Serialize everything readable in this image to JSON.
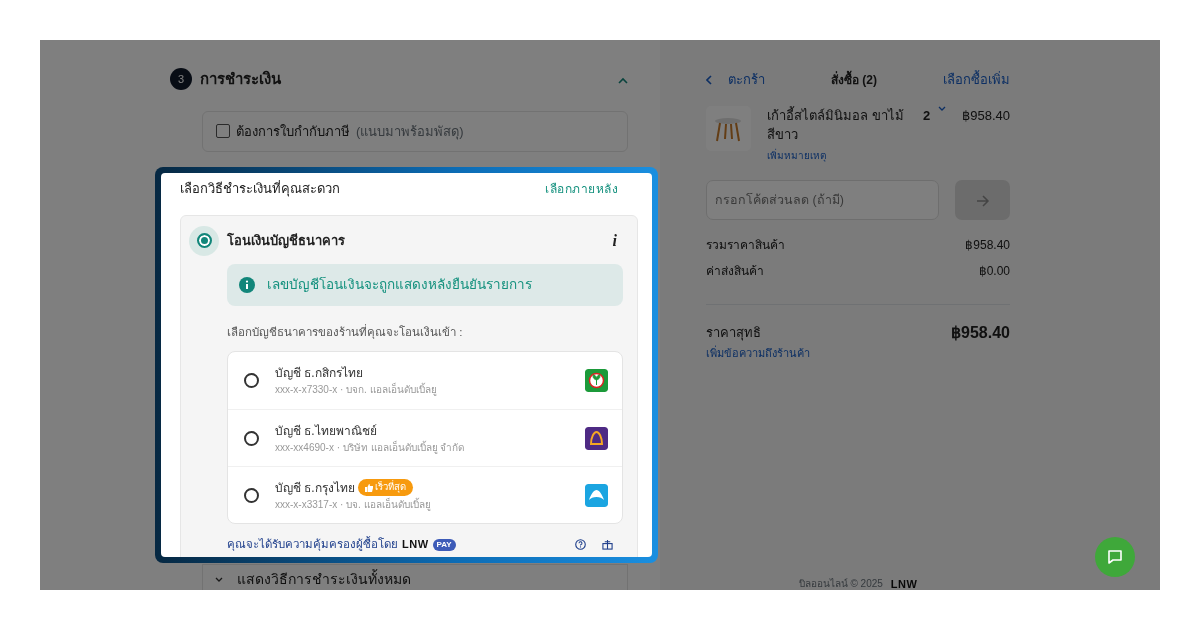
{
  "checkout": {
    "step_number": "3",
    "title": "การชำระเงิน",
    "expanded": true,
    "tax_invoice": {
      "label": "ต้องการใบกำกับภาษี",
      "note": "(แนบมาพร้อมพัสดุ)",
      "checked": false
    },
    "show_all": "แสดงวิธีการชำระเงินทั้งหมด"
  },
  "modal": {
    "title": "เลือกวิธีชำระเงินที่คุณสะดวก",
    "later_link": "เลือกภายหลัง",
    "method": {
      "label": "โอนเงินบัญชีธนาคาร",
      "selected": true,
      "info_glyph": "i",
      "notice": "เลขบัญชีโอนเงินจะถูกแสดงหลังยืนยันรายการ",
      "prompt": "เลือกบัญชีธนาคารของร้านที่คุณจะโอนเงินเข้า :",
      "banks": [
        {
          "name": "บัญชี ธ.กสิกรไทย",
          "detail": "xxx-x-x7330-x · บจก. แอลเอ็นดับเบิ้ลยู",
          "kind": "leaf",
          "color": "#1c9a3a",
          "selected": false
        },
        {
          "name": "บัญชี ธ.ไทยพาณิชย์",
          "detail": "xxx-xx4690-x · บริษัท แอลเอ็นดับเบิ้ลยู จำกัด",
          "kind": "shell",
          "color": "#4e2a84",
          "selected": false
        },
        {
          "name": "บัญชี ธ.กรุงไทย",
          "badge": "เร็วที่สุด",
          "detail": "xxx-x-x3317-x · บจ. แอลเอ็นดับเบิ้ลยู",
          "kind": "bird",
          "color": "#1ba5e1",
          "selected": false
        }
      ]
    },
    "protection": {
      "text": "คุณจะได้รับความคุ้มครองผู้ซื้อโดย",
      "logo": "LNW",
      "logo_badge": "PAY"
    }
  },
  "cart": {
    "back": "ตะกร้า",
    "title": "สั่งซื้อ (2)",
    "more_link": "เลือกซื้อเพิ่ม",
    "item": {
      "name": "เก้าอี้สไตล์มินิมอล ขาไม้ สีขาว",
      "note_link": "เพิ่มหมายเหตุ",
      "quantity": "2",
      "price": "฿958.40"
    },
    "coupon": {
      "placeholder": "กรอกโค้ดส่วนลด (ถ้ามี)"
    },
    "summary": [
      {
        "label": "รวมราคาสินค้า",
        "value": "฿958.40"
      },
      {
        "label": "ค่าส่งสินค้า",
        "value": "฿0.00"
      }
    ],
    "total": {
      "label": "ราคาสุทธิ",
      "value": "฿958.40"
    },
    "message_link": "เพิ่มข้อความถึงร้านค้า",
    "footer": {
      "text": "บิลออนไลน์ © 2025",
      "logo": "LNW"
    }
  }
}
